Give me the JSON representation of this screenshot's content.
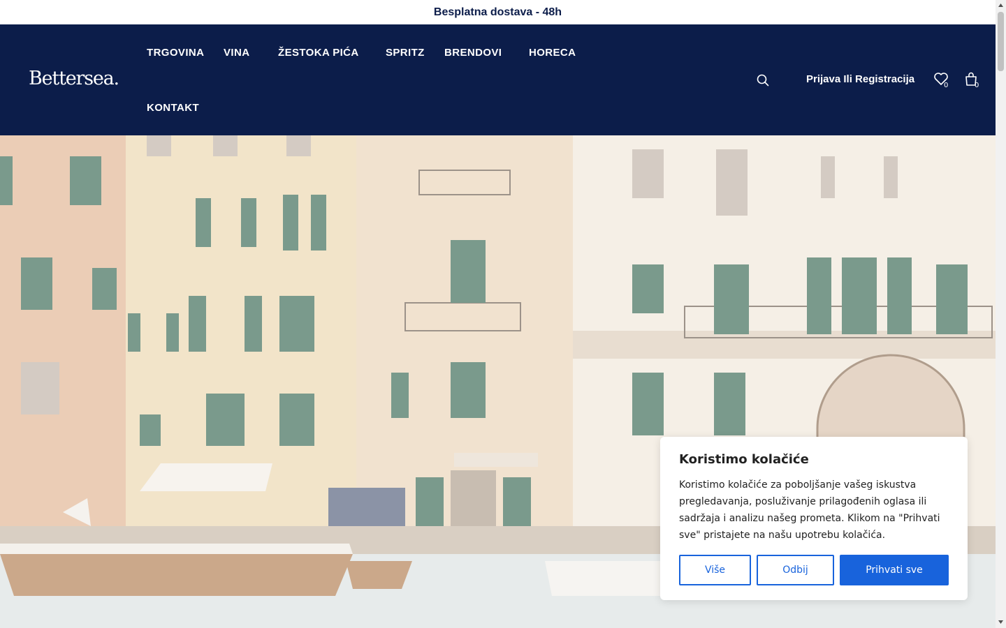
{
  "announcement": "Besplatna dostava - 48h",
  "logo": "Bettersea.",
  "nav": {
    "shop": "TRGOVINA",
    "wines": "VINA",
    "spirits": "ŽESTOKA PIĆA",
    "spritz": "SPRITZ",
    "brands": "BRENDOVI",
    "horeca": "HORECA",
    "contact": "KONTAKT"
  },
  "header": {
    "login": "Prijava Ili Registracija",
    "wishlist_count": "0",
    "cart_count": "0",
    "icons": [
      "search-icon",
      "heart-icon",
      "shopping-bag-icon"
    ]
  },
  "cookie_banner": {
    "title": "Koristimo kolačiće",
    "text": "Koristimo kolačiće za poboljšanje vašeg iskustva pregledavanja, posluživanje prilagođenih oglasa ili sadržaja i analizu našeg prometa. Klikom na \"Prihvati sve\" pristajete na našu upotrebu kolačića.",
    "more_label": "Više",
    "reject_label": "Odbij",
    "accept_label": "Prihvati sve"
  },
  "colors": {
    "brand_navy": "#0c1d4a",
    "cookie_accent": "#1863dc"
  }
}
